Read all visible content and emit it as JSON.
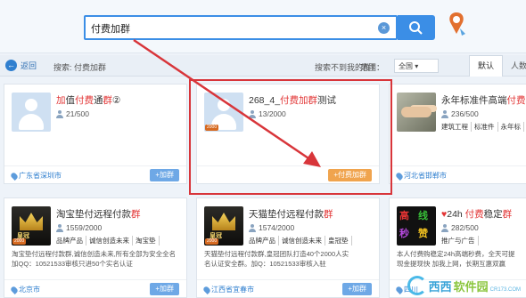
{
  "search": {
    "value": "付费加群"
  },
  "subbar": {
    "back": "返回",
    "search_label": "搜索: 付费加群",
    "hint": "搜索不到我的群？",
    "range_label": "范围：",
    "range_value": "全国",
    "tab_default": "默认",
    "tab_people": "人数"
  },
  "cards": [
    {
      "title_a": "加",
      "title_b": "值",
      "title_c": "付费",
      "title_d": "通",
      "title_e": "群",
      "title_f": "②",
      "count": "21/500",
      "location": "广东省深圳市",
      "join": "+加群"
    },
    {
      "title_a": "268_4_",
      "title_c": "付费加群",
      "title_d": "测试",
      "count": "13/2000",
      "location": "",
      "join": "+付费加群"
    },
    {
      "title_a": "永年标准件高端",
      "title_c": "付费",
      "title_e": "群",
      "count": "236/500",
      "tags": [
        "建筑工程",
        "标准件",
        "永年标"
      ],
      "location": "河北省邯郸市",
      "join": "+加群"
    },
    {
      "title_a": "淘宝垫付远程付款",
      "title_e": "群",
      "count": "1559/2000",
      "tags": [
        "品牌产品",
        "诚信创造未来",
        "淘宝垫"
      ],
      "desc_a": "淘宝垫付远程付款群,诚信创造未来,所有全部为安全全名",
      "desc_b": "加QQ：10521533审核只进50个实名认证",
      "location": "北京市",
      "join": "+加群"
    },
    {
      "title_a": "天猫垫付远程付款",
      "title_e": "群",
      "count": "1574/2000",
      "tags": [
        "品牌产品",
        "诚信创造未来",
        "皇冠垫"
      ],
      "desc_a": "天猫垫付远程付款群,皇冠团队打造40个2000人实",
      "desc_b": "名认证安全群。加Q：10521533审核入驻",
      "location": "江西省宜春市",
      "join": "+加群"
    },
    {
      "title_a": "24h ",
      "title_c": "付费",
      "title_d": "稳定",
      "title_e": "群",
      "count": "282/500",
      "tags": [
        "推广与广告"
      ],
      "desc_a": "本人付费购稳定24h高端秒费，全天可提",
      "desc_b": "现金提现快 加我上网，长期互惠双赢",
      "location": "四川",
      "join": "+加群"
    }
  ],
  "avatar_words": {
    "crown": "皇冠",
    "colorful": [
      "高",
      "线",
      "秒",
      "赞"
    ]
  },
  "watermark": {
    "name": "西西",
    "brand": "软件园",
    "sub": "CR173.COM"
  }
}
